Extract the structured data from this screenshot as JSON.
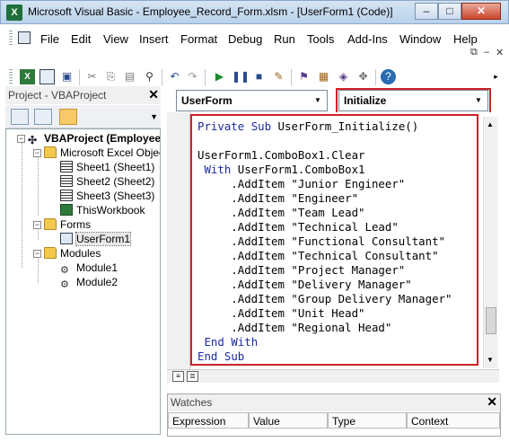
{
  "window": {
    "title": "Microsoft Visual Basic - Employee_Record_Form.xlsm - [UserForm1 (Code)]",
    "app_icon": "excel-icon",
    "minimize": "–",
    "maximize": "□",
    "close": "✕"
  },
  "menubar": {
    "items": [
      "File",
      "Edit",
      "View",
      "Insert",
      "Format",
      "Debug",
      "Run",
      "Tools",
      "Add-Ins",
      "Window",
      "Help"
    ],
    "controls": [
      "–",
      "⧉",
      "✕"
    ]
  },
  "toolbar": {
    "icons": [
      "view-excel-icon",
      "insert-userform-icon",
      "save-icon",
      "cut-icon",
      "copy-icon",
      "paste-icon",
      "find-icon",
      "undo-icon",
      "redo-icon",
      "run-icon",
      "break-icon",
      "reset-icon",
      "design-mode-icon",
      "project-explorer-icon",
      "properties-icon",
      "object-browser-icon",
      "toolbox-icon",
      "help-icon"
    ]
  },
  "project_pane": {
    "title": "Project - VBAProject",
    "close": "✕",
    "tree": {
      "root": "VBAProject (Employee",
      "excel_objects": "Microsoft Excel Objects",
      "sheets": [
        "Sheet1 (Sheet1)",
        "Sheet2 (Sheet2)",
        "Sheet3 (Sheet3)"
      ],
      "workbook": "ThisWorkbook",
      "forms_folder": "Forms",
      "forms": [
        "UserForm1"
      ],
      "modules_folder": "Modules",
      "modules": [
        "Module1",
        "Module2"
      ]
    }
  },
  "code_window": {
    "object_combo": "UserForm",
    "procedure_combo": "Initialize",
    "lines": [
      "Private Sub UserForm_Initialize()",
      "",
      "UserForm1.ComboBox1.Clear",
      " With UserForm1.ComboBox1",
      "     .AddItem \"Junior Engineer\"",
      "     .AddItem \"Engineer\"",
      "     .AddItem \"Team Lead\"",
      "     .AddItem \"Technical Lead\"",
      "     .AddItem \"Functional Consultant\"",
      "     .AddItem \"Technical Consultant\"",
      "     .AddItem \"Project Manager\"",
      "     .AddItem \"Delivery Manager\"",
      "     .AddItem \"Group Delivery Manager\"",
      "     .AddItem \"Unit Head\"",
      "     .AddItem \"Regional Head\"",
      " End With",
      "End Sub"
    ],
    "highlight_color": "#d0202a"
  },
  "watches": {
    "title": "Watches",
    "close": "✕",
    "columns": [
      "Expression",
      "Value",
      "Type",
      "Context"
    ]
  }
}
